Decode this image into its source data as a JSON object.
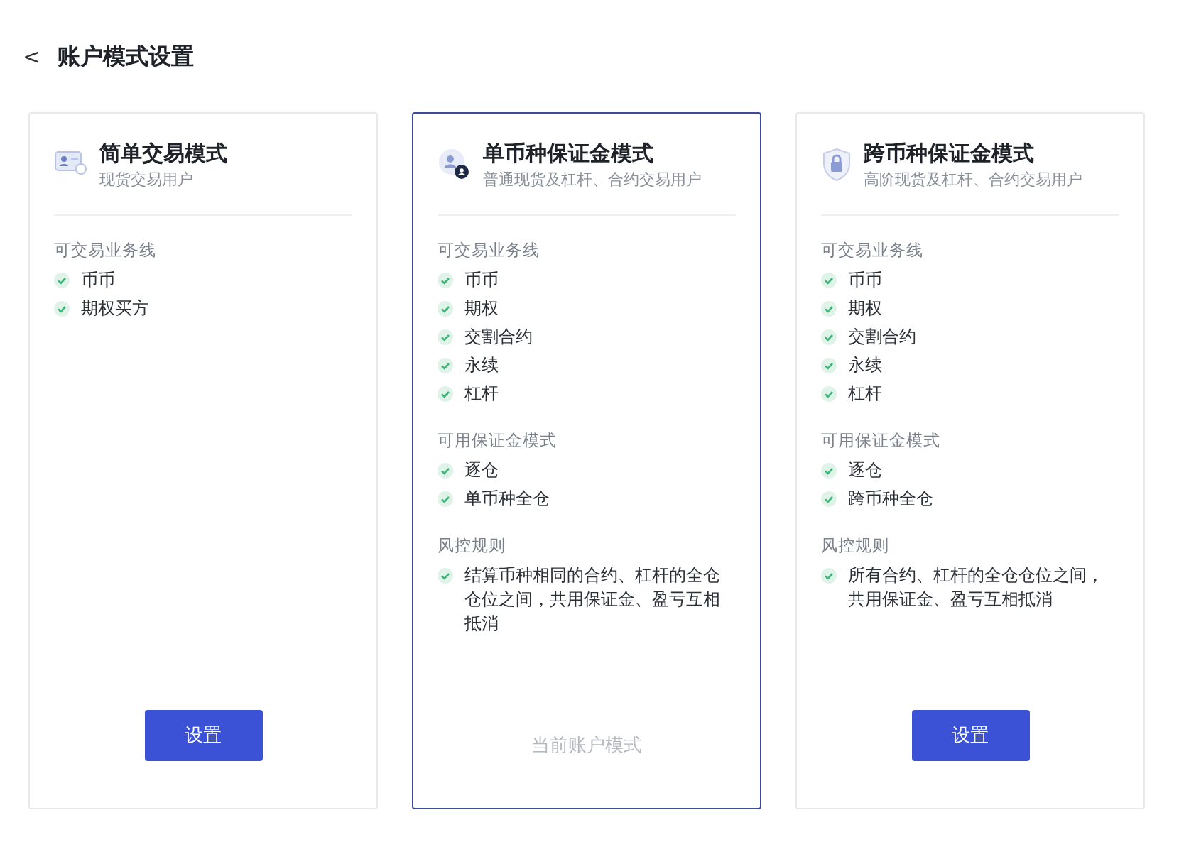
{
  "header": {
    "back": "<",
    "title": "账户模式设置"
  },
  "cards": [
    {
      "title": "简单交易模式",
      "subtitle": "现货交易用户",
      "selected": false,
      "sections": [
        {
          "heading": "可交易业务线",
          "items": [
            "币币",
            "期权买方"
          ]
        }
      ],
      "action": {
        "kind": "button",
        "label": "设置"
      }
    },
    {
      "title": "单币种保证金模式",
      "subtitle": "普通现货及杠杆、合约交易用户",
      "selected": true,
      "sections": [
        {
          "heading": "可交易业务线",
          "items": [
            "币币",
            "期权",
            "交割合约",
            "永续",
            "杠杆"
          ]
        },
        {
          "heading": "可用保证金模式",
          "items": [
            "逐仓",
            "单币种全仓"
          ]
        },
        {
          "heading": "风控规则",
          "items": [
            "结算币种相同的合约、杠杆的全仓仓位之间，共用保证金、盈亏互相抵消"
          ]
        }
      ],
      "action": {
        "kind": "status",
        "label": "当前账户模式"
      }
    },
    {
      "title": "跨币种保证金模式",
      "subtitle": "高阶现货及杠杆、合约交易用户",
      "selected": false,
      "sections": [
        {
          "heading": "可交易业务线",
          "items": [
            "币币",
            "期权",
            "交割合约",
            "永续",
            "杠杆"
          ]
        },
        {
          "heading": "可用保证金模式",
          "items": [
            "逐仓",
            "跨币种全仓"
          ]
        },
        {
          "heading": "风控规则",
          "items": [
            "所有合约、杠杆的全仓仓位之间，共用保证金、盈亏互相抵消"
          ]
        }
      ],
      "action": {
        "kind": "button",
        "label": "设置"
      }
    }
  ]
}
